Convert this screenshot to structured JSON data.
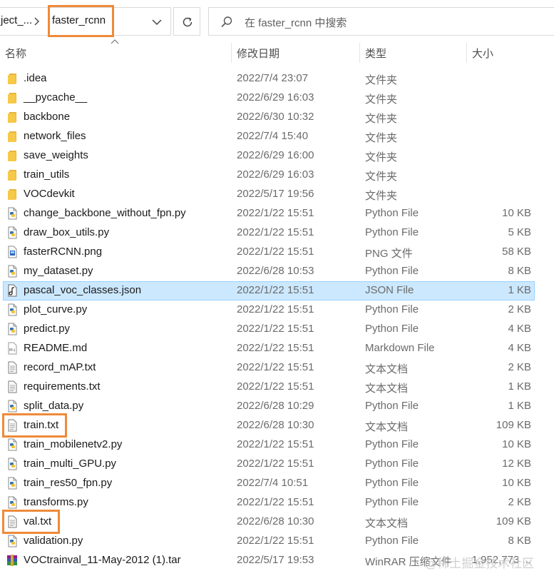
{
  "address": {
    "prev_crumb": "ject_...",
    "current_crumb": "faster_rcnn"
  },
  "search": {
    "placeholder": "在 faster_rcnn 中搜索"
  },
  "columns": {
    "name": "名称",
    "date": "修改日期",
    "type": "类型",
    "size": "大小"
  },
  "colors": {
    "accent_outline": "#ee8a3a",
    "selection": "#cce8ff",
    "folder": "#f7c948"
  },
  "files": [
    {
      "icon": "folder-icon",
      "name": ".idea",
      "date": "2022/7/4 23:07",
      "type": "文件夹",
      "size": ""
    },
    {
      "icon": "folder-icon",
      "name": "__pycache__",
      "date": "2022/6/29 16:03",
      "type": "文件夹",
      "size": ""
    },
    {
      "icon": "folder-icon",
      "name": "backbone",
      "date": "2022/6/30 10:32",
      "type": "文件夹",
      "size": ""
    },
    {
      "icon": "folder-icon",
      "name": "network_files",
      "date": "2022/7/4 15:40",
      "type": "文件夹",
      "size": ""
    },
    {
      "icon": "folder-icon",
      "name": "save_weights",
      "date": "2022/6/29 16:00",
      "type": "文件夹",
      "size": ""
    },
    {
      "icon": "folder-icon",
      "name": "train_utils",
      "date": "2022/6/29 16:03",
      "type": "文件夹",
      "size": ""
    },
    {
      "icon": "folder-icon",
      "name": "VOCdevkit",
      "date": "2022/5/17 19:56",
      "type": "文件夹",
      "size": ""
    },
    {
      "icon": "python-file-icon",
      "name": "change_backbone_without_fpn.py",
      "date": "2022/1/22 15:51",
      "type": "Python File",
      "size": "10 KB"
    },
    {
      "icon": "python-file-icon",
      "name": "draw_box_utils.py",
      "date": "2022/1/22 15:51",
      "type": "Python File",
      "size": "5 KB"
    },
    {
      "icon": "png-file-icon",
      "name": "fasterRCNN.png",
      "date": "2022/1/22 15:51",
      "type": "PNG 文件",
      "size": "58 KB"
    },
    {
      "icon": "python-file-icon",
      "name": "my_dataset.py",
      "date": "2022/6/28 10:53",
      "type": "Python File",
      "size": "8 KB"
    },
    {
      "icon": "json-file-icon",
      "name": "pascal_voc_classes.json",
      "date": "2022/1/22 15:51",
      "type": "JSON File",
      "size": "1 KB",
      "selected": true
    },
    {
      "icon": "python-file-icon",
      "name": "plot_curve.py",
      "date": "2022/1/22 15:51",
      "type": "Python File",
      "size": "2 KB"
    },
    {
      "icon": "python-file-icon",
      "name": "predict.py",
      "date": "2022/1/22 15:51",
      "type": "Python File",
      "size": "4 KB"
    },
    {
      "icon": "markdown-file-icon",
      "name": "README.md",
      "date": "2022/1/22 15:51",
      "type": "Markdown File",
      "size": "4 KB"
    },
    {
      "icon": "text-file-icon",
      "name": "record_mAP.txt",
      "date": "2022/1/22 15:51",
      "type": "文本文档",
      "size": "2 KB"
    },
    {
      "icon": "text-file-icon",
      "name": "requirements.txt",
      "date": "2022/1/22 15:51",
      "type": "文本文档",
      "size": "1 KB"
    },
    {
      "icon": "python-file-icon",
      "name": "split_data.py",
      "date": "2022/6/28 10:29",
      "type": "Python File",
      "size": "1 KB"
    },
    {
      "icon": "text-file-icon",
      "name": "train.txt",
      "date": "2022/6/28 10:30",
      "type": "文本文档",
      "size": "109 KB",
      "highlighted": true
    },
    {
      "icon": "python-file-icon",
      "name": "train_mobilenetv2.py",
      "date": "2022/1/22 15:51",
      "type": "Python File",
      "size": "10 KB"
    },
    {
      "icon": "python-file-icon",
      "name": "train_multi_GPU.py",
      "date": "2022/1/22 15:51",
      "type": "Python File",
      "size": "12 KB"
    },
    {
      "icon": "python-file-icon",
      "name": "train_res50_fpn.py",
      "date": "2022/7/4 10:51",
      "type": "Python File",
      "size": "10 KB"
    },
    {
      "icon": "python-file-icon",
      "name": "transforms.py",
      "date": "2022/1/22 15:51",
      "type": "Python File",
      "size": "2 KB"
    },
    {
      "icon": "text-file-icon",
      "name": "val.txt",
      "date": "2022/6/28 10:30",
      "type": "文本文档",
      "size": "109 KB",
      "highlighted": true
    },
    {
      "icon": "python-file-icon",
      "name": "validation.py",
      "date": "2022/1/22 15:51",
      "type": "Python File",
      "size": "8 KB"
    },
    {
      "icon": "winrar-archive-icon",
      "name": "VOCtrainval_11-May-2012 (1).tar",
      "date": "2022/5/17 19:53",
      "type": "WinRAR 压缩文件",
      "size": "1,952,773 ..."
    }
  ],
  "watermark": "@稀土掘金技术社区"
}
